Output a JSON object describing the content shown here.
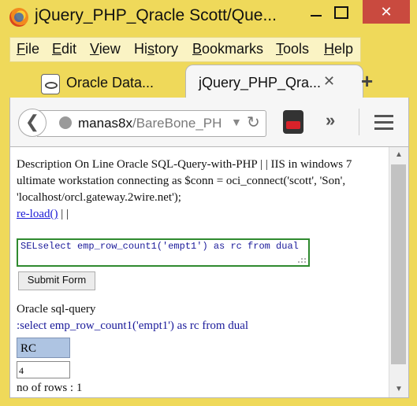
{
  "window": {
    "title": "jQuery_PHP_Qracle Scott/Que...",
    "min_label": "",
    "max_label": "",
    "close_label": "✕"
  },
  "menu": {
    "items": [
      "File",
      "Edit",
      "View",
      "History",
      "Bookmarks",
      "Tools",
      "Help"
    ],
    "accels": [
      "F",
      "E",
      "V",
      "s",
      "B",
      "T",
      "H"
    ]
  },
  "tabs": [
    {
      "label": "Oracle Data...",
      "close": "✕",
      "icon": "oracle-page-icon"
    },
    {
      "label": "jQuery_PHP_Qra...",
      "close": "✕",
      "active": true
    }
  ],
  "newtab_label": "+",
  "nav": {
    "back_glyph": "❮",
    "url_host": "manas8x",
    "url_path": "/BareBone_PH",
    "dropdown_glyph": "▼",
    "reload_glyph": "↻",
    "overflow_glyph": "»",
    "youtube_icon": "youtube-icon"
  },
  "page": {
    "description": "Description On Line Oracle SQL-Query-with-PHP | | IIS in windows 7 ultimate workstation connecting as $conn = oci_connect('scott', 'Son', 'localhost/orcl.gateway.2wire.net');",
    "reload_link": "re-load()",
    "reload_suffix": "| |",
    "textarea_value": "SELselect emp_row_count1('empt1') as rc from dual",
    "submit_label": "Submit Form",
    "oracle_label": "Oracle sql-query",
    "query_echo": ":select emp_row_count1('empt1') as rc from dual",
    "table": {
      "header": "RC",
      "value": "4"
    },
    "rows_count": "no of rows : 1"
  },
  "scrollbar": {
    "up_glyph": "▲",
    "down_glyph": "▼"
  },
  "colors": {
    "frame": "#efd95a",
    "textarea_border": "#2f8a2f",
    "link": "#1a1ad6",
    "query_text": "#1a1a9a",
    "table_header": "#aec4e2",
    "close_button": "#c94a3f"
  }
}
